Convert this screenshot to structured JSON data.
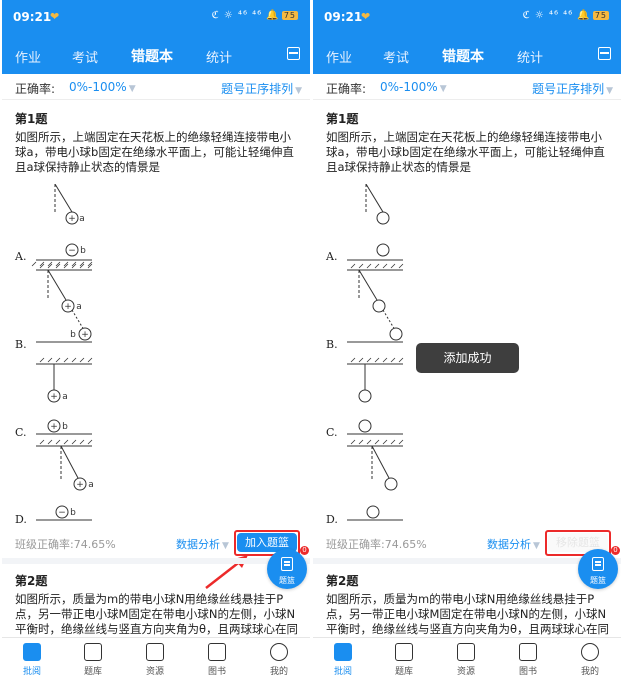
{
  "status_bar": {
    "time": "09:21",
    "heart": "❤",
    "icons": "ℭ ☼ ⁴⁶ ⁴⁶ 🔔",
    "battery": "75"
  },
  "nav": {
    "tabs": [
      "作业",
      "考试",
      "错题本",
      "统计"
    ],
    "active_tab": "错题本",
    "scan_icon": "scan-icon"
  },
  "filter": {
    "accuracy_label": "正确率:",
    "accuracy_value": "0%-100%",
    "sort_label": "题号正序排列"
  },
  "question1": {
    "title": "第1题",
    "text": "如图所示，上端固定在天花板上的绝缘轻绳连接带电小球a，带电小球b固定在绝缘水平面上，可能让轻绳伸直且a球保持静止状态的情景是",
    "options": [
      "A.",
      "B.",
      "C.",
      "D."
    ],
    "ball_a": "a",
    "ball_b": "b",
    "plus": "+",
    "minus": "−"
  },
  "stats": {
    "class_rate": "班级正确率:74.65%",
    "analysis": "数据分析",
    "add_button": "加入题篮",
    "remove_button": "移除题篮"
  },
  "fab": {
    "label": "题篮",
    "badge": "0"
  },
  "toast": "添加成功",
  "question2": {
    "title": "第2题",
    "text": "如图所示，质量为m的带电小球N用绝缘丝线悬挂于P点，另一带正电小球M固定在带电小球N的左侧，小球N平衡时，绝缘丝线与竖直方向夹角为θ，且两球球心在同一水平线上，关于小球N的电性和所受库仑力的"
  },
  "bottom_nav": [
    "批阅",
    "题库",
    "资源",
    "图书",
    "我的"
  ],
  "active_bottom": "批阅",
  "colors": {
    "primary": "#1a8ef0",
    "highlight": "#ec2a2a",
    "toast_bg": "#3e3e3e"
  }
}
